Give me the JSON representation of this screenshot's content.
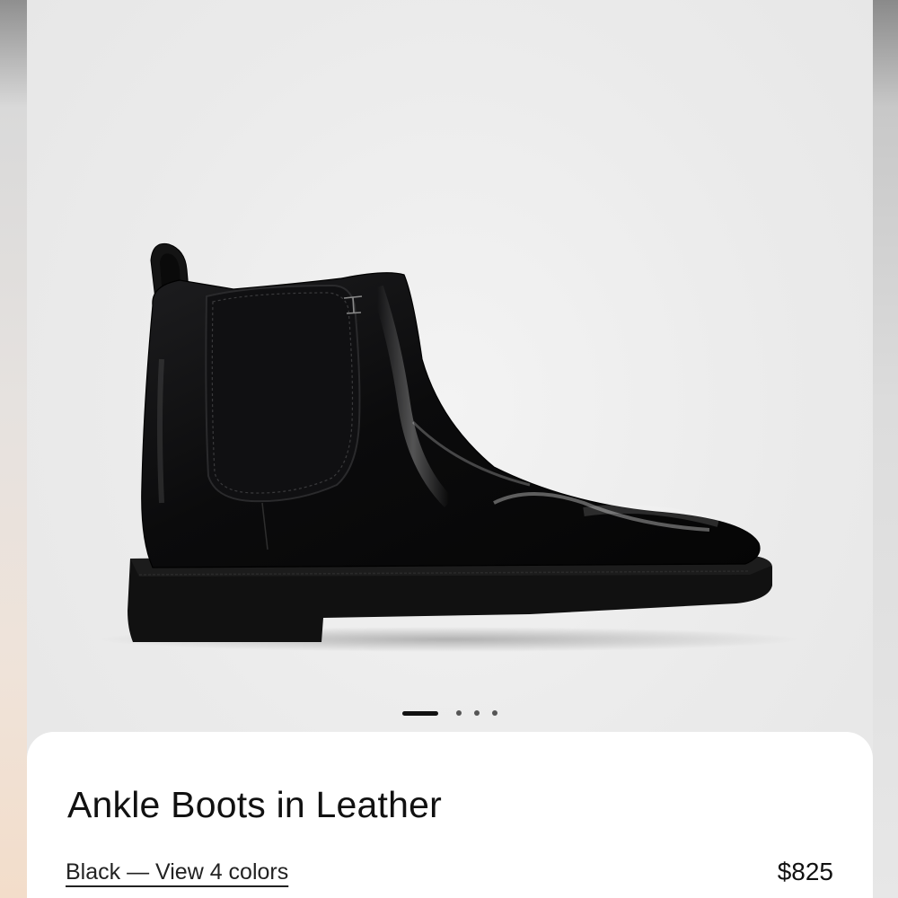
{
  "product": {
    "title": "Ankle Boots in Leather",
    "color_link": "Black — View 4 colors",
    "price": "$825",
    "image_alt": "boot-product-image"
  },
  "carousel": {
    "total_slides": 4,
    "active_index": 0
  },
  "colors": {
    "card_background": "#ffffff",
    "stage_background": "#ebebeb",
    "text": "#111111",
    "active_dot": "#111111",
    "inactive_dot": "#555555"
  }
}
